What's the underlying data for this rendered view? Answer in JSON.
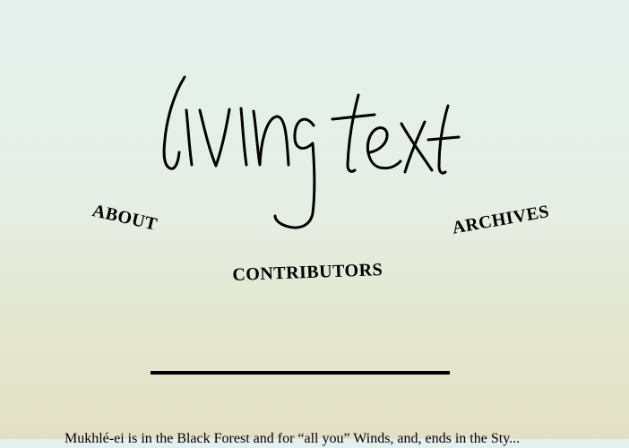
{
  "site": {
    "logo_text": "living text"
  },
  "nav": {
    "about": "ABOUT",
    "archives": "ARCHIVES",
    "contributors": "CONTRIBUTORS"
  },
  "intro": {
    "text": "Mukhlé-ei is in the Black Forest and for “all you” Winds, and, ends in the Sty..."
  },
  "colors": {
    "background_top": "#e3f0ed",
    "background_bottom": "#e2e0c4",
    "ink": "#000000"
  }
}
